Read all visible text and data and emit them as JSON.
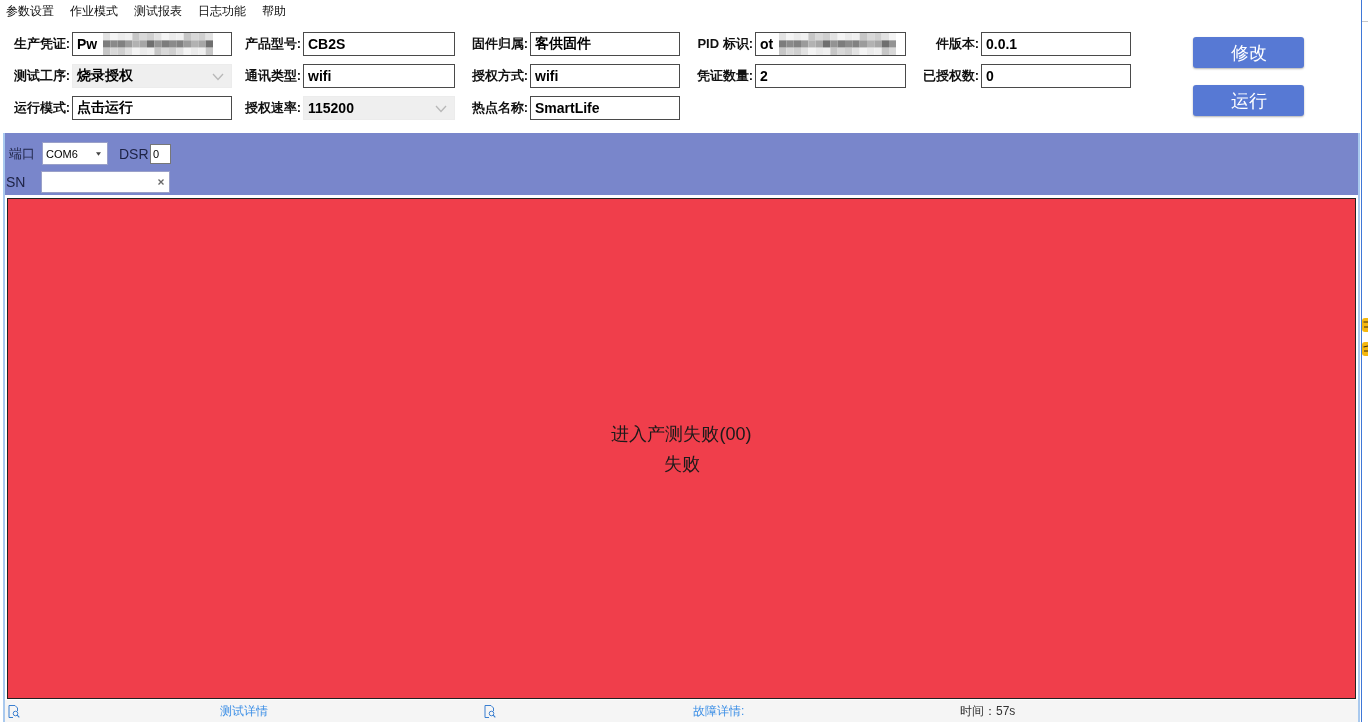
{
  "menu_bar": [
    {
      "label": "参数设置"
    },
    {
      "label": "作业模式"
    },
    {
      "label": "测试报表"
    },
    {
      "label": "日志功能"
    },
    {
      "label": "帮助"
    }
  ],
  "form": {
    "rows": [
      [
        {
          "label": "生产凭证:",
          "kind": "text",
          "value": "Pw",
          "redacted": true
        },
        {
          "label": "产品型号:",
          "kind": "text",
          "value": "CB2S",
          "redacted": false
        },
        {
          "label": "固件归属:",
          "kind": "text",
          "value": "客供固件",
          "redacted": false
        },
        {
          "label": "PID 标识:",
          "kind": "text",
          "value": "ot",
          "redacted": true
        },
        {
          "label": "件版本:",
          "kind": "text",
          "value": "0.0.1",
          "redacted": false
        }
      ],
      [
        {
          "label": "测试工序:",
          "kind": "select",
          "value": "烧录授权",
          "redacted": false
        },
        {
          "label": "通讯类型:",
          "kind": "text",
          "value": "wifi",
          "redacted": false
        },
        {
          "label": "授权方式:",
          "kind": "text",
          "value": "wifi",
          "redacted": false
        },
        {
          "label": "凭证数量:",
          "kind": "text",
          "value": "2",
          "redacted": false
        },
        {
          "label": "已授权数:",
          "kind": "text",
          "value": "0",
          "redacted": false
        }
      ],
      [
        {
          "label": "运行模式:",
          "kind": "text",
          "value": "点击运行",
          "redacted": false
        },
        {
          "label": "授权速率:",
          "kind": "select",
          "value": "115200",
          "redacted": false
        },
        {
          "label": "热点名称:",
          "kind": "text",
          "value": "SmartLife",
          "redacted": false
        }
      ]
    ]
  },
  "buttons": [
    {
      "label": "修改"
    },
    {
      "label": "运行"
    }
  ],
  "port_panel": {
    "port_label": "端口",
    "port_value": "COM6",
    "dsr_label": "DSR",
    "dsr_value": "0",
    "sn_label": "SN"
  },
  "result_panel": {
    "failed": true,
    "lines": [
      "进入产测失败(00)",
      "失败"
    ]
  },
  "status_bar": {
    "test_details": "测试详情",
    "fault_details": "故障详情:",
    "time": "时间：57s"
  }
}
